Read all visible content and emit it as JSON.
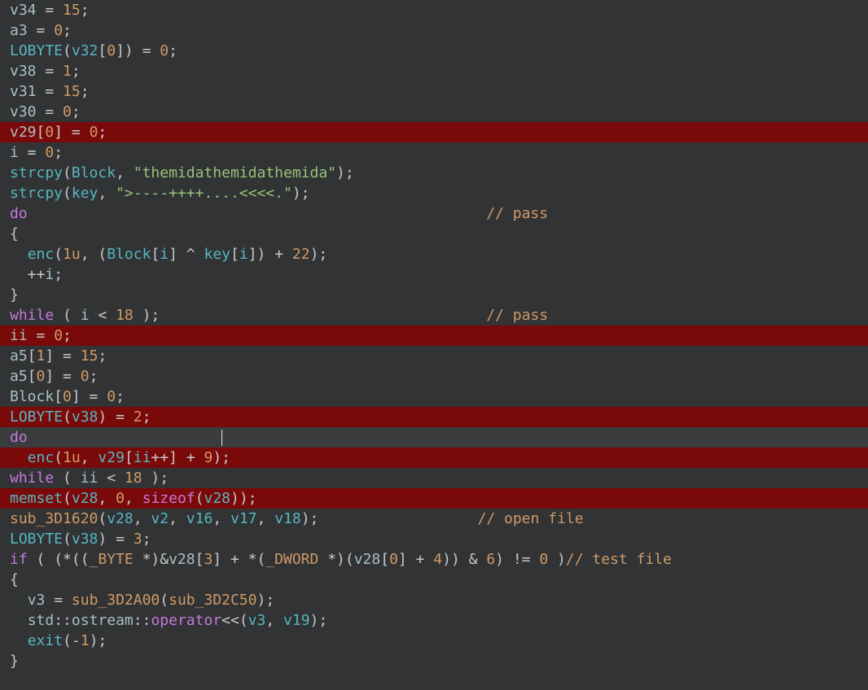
{
  "lines": [
    {
      "hl": "",
      "tokens": [
        {
          "t": "v34",
          "c": "c-var"
        },
        {
          "t": " = ",
          "c": "c-punc"
        },
        {
          "t": "15",
          "c": "c-num"
        },
        {
          "t": ";",
          "c": "c-punc"
        }
      ]
    },
    {
      "hl": "",
      "tokens": [
        {
          "t": "a3",
          "c": "c-var"
        },
        {
          "t": " = ",
          "c": "c-punc"
        },
        {
          "t": "0",
          "c": "c-num"
        },
        {
          "t": ";",
          "c": "c-punc"
        }
      ]
    },
    {
      "hl": "",
      "tokens": [
        {
          "t": "LOBYTE",
          "c": "c-func"
        },
        {
          "t": "(",
          "c": "c-punc"
        },
        {
          "t": "v32",
          "c": "c-id"
        },
        {
          "t": "[",
          "c": "c-punc"
        },
        {
          "t": "0",
          "c": "c-num"
        },
        {
          "t": "]) = ",
          "c": "c-punc"
        },
        {
          "t": "0",
          "c": "c-num"
        },
        {
          "t": ";",
          "c": "c-punc"
        }
      ]
    },
    {
      "hl": "",
      "tokens": [
        {
          "t": "v38",
          "c": "c-var"
        },
        {
          "t": " = ",
          "c": "c-punc"
        },
        {
          "t": "1",
          "c": "c-num"
        },
        {
          "t": ";",
          "c": "c-punc"
        }
      ]
    },
    {
      "hl": "",
      "tokens": [
        {
          "t": "v31",
          "c": "c-var"
        },
        {
          "t": " = ",
          "c": "c-punc"
        },
        {
          "t": "15",
          "c": "c-num"
        },
        {
          "t": ";",
          "c": "c-punc"
        }
      ]
    },
    {
      "hl": "",
      "tokens": [
        {
          "t": "v30",
          "c": "c-var"
        },
        {
          "t": " = ",
          "c": "c-punc"
        },
        {
          "t": "0",
          "c": "c-num"
        },
        {
          "t": ";",
          "c": "c-punc"
        }
      ]
    },
    {
      "hl": "hl-red",
      "tokens": [
        {
          "t": "v29",
          "c": "c-var"
        },
        {
          "t": "[",
          "c": "c-punc"
        },
        {
          "t": "0",
          "c": "c-num"
        },
        {
          "t": "] = ",
          "c": "c-punc"
        },
        {
          "t": "0",
          "c": "c-num"
        },
        {
          "t": ";",
          "c": "c-punc"
        }
      ]
    },
    {
      "hl": "",
      "tokens": [
        {
          "t": "i",
          "c": "c-var"
        },
        {
          "t": " = ",
          "c": "c-punc"
        },
        {
          "t": "0",
          "c": "c-num"
        },
        {
          "t": ";",
          "c": "c-punc"
        }
      ]
    },
    {
      "hl": "",
      "tokens": [
        {
          "t": "strcpy",
          "c": "c-func"
        },
        {
          "t": "(",
          "c": "c-punc"
        },
        {
          "t": "Block",
          "c": "c-id"
        },
        {
          "t": ", ",
          "c": "c-punc"
        },
        {
          "t": "\"themidathemidathemida\"",
          "c": "c-str"
        },
        {
          "t": ");",
          "c": "c-punc"
        }
      ]
    },
    {
      "hl": "",
      "tokens": [
        {
          "t": "strcpy",
          "c": "c-func"
        },
        {
          "t": "(",
          "c": "c-punc"
        },
        {
          "t": "key",
          "c": "c-id"
        },
        {
          "t": ", ",
          "c": "c-punc"
        },
        {
          "t": "\">----++++....<<<<.\"",
          "c": "c-str"
        },
        {
          "t": ");",
          "c": "c-punc"
        }
      ]
    },
    {
      "hl": "",
      "tokens": [
        {
          "t": "do",
          "c": "c-kw"
        },
        {
          "t": "                                                    ",
          "c": "c-punc"
        },
        {
          "t": "// pass",
          "c": "c-cmt"
        }
      ]
    },
    {
      "hl": "",
      "tokens": [
        {
          "t": "{",
          "c": "c-punc"
        }
      ]
    },
    {
      "hl": "",
      "tokens": [
        {
          "t": "  ",
          "c": "c-punc"
        },
        {
          "t": "enc",
          "c": "c-func"
        },
        {
          "t": "(",
          "c": "c-punc"
        },
        {
          "t": "1u",
          "c": "c-num"
        },
        {
          "t": ", (",
          "c": "c-punc"
        },
        {
          "t": "Block",
          "c": "c-id"
        },
        {
          "t": "[",
          "c": "c-punc"
        },
        {
          "t": "i",
          "c": "c-id"
        },
        {
          "t": "] ^ ",
          "c": "c-punc"
        },
        {
          "t": "key",
          "c": "c-id"
        },
        {
          "t": "[",
          "c": "c-punc"
        },
        {
          "t": "i",
          "c": "c-id"
        },
        {
          "t": "]) + ",
          "c": "c-punc"
        },
        {
          "t": "22",
          "c": "c-num"
        },
        {
          "t": ");",
          "c": "c-punc"
        }
      ]
    },
    {
      "hl": "",
      "tokens": [
        {
          "t": "  ++",
          "c": "c-punc"
        },
        {
          "t": "i",
          "c": "c-var"
        },
        {
          "t": ";",
          "c": "c-punc"
        }
      ]
    },
    {
      "hl": "",
      "tokens": [
        {
          "t": "}",
          "c": "c-punc"
        }
      ]
    },
    {
      "hl": "",
      "tokens": [
        {
          "t": "while",
          "c": "c-kw"
        },
        {
          "t": " ( ",
          "c": "c-punc"
        },
        {
          "t": "i",
          "c": "c-var"
        },
        {
          "t": " < ",
          "c": "c-punc"
        },
        {
          "t": "18",
          "c": "c-num"
        },
        {
          "t": " );",
          "c": "c-punc"
        },
        {
          "t": "                                     ",
          "c": "c-punc"
        },
        {
          "t": "// pass",
          "c": "c-cmt"
        }
      ]
    },
    {
      "hl": "hl-red",
      "tokens": [
        {
          "t": "ii",
          "c": "c-var"
        },
        {
          "t": " = ",
          "c": "c-punc"
        },
        {
          "t": "0",
          "c": "c-num"
        },
        {
          "t": ";",
          "c": "c-punc"
        }
      ]
    },
    {
      "hl": "",
      "tokens": [
        {
          "t": "a5",
          "c": "c-var"
        },
        {
          "t": "[",
          "c": "c-punc"
        },
        {
          "t": "1",
          "c": "c-num"
        },
        {
          "t": "] = ",
          "c": "c-punc"
        },
        {
          "t": "15",
          "c": "c-num"
        },
        {
          "t": ";",
          "c": "c-punc"
        }
      ]
    },
    {
      "hl": "",
      "tokens": [
        {
          "t": "a5",
          "c": "c-var"
        },
        {
          "t": "[",
          "c": "c-punc"
        },
        {
          "t": "0",
          "c": "c-num"
        },
        {
          "t": "] = ",
          "c": "c-punc"
        },
        {
          "t": "0",
          "c": "c-num"
        },
        {
          "t": ";",
          "c": "c-punc"
        }
      ]
    },
    {
      "hl": "",
      "tokens": [
        {
          "t": "Block",
          "c": "c-var"
        },
        {
          "t": "[",
          "c": "c-punc"
        },
        {
          "t": "0",
          "c": "c-num"
        },
        {
          "t": "] = ",
          "c": "c-punc"
        },
        {
          "t": "0",
          "c": "c-num"
        },
        {
          "t": ";",
          "c": "c-punc"
        }
      ]
    },
    {
      "hl": "hl-red",
      "tokens": [
        {
          "t": "LOBYTE",
          "c": "c-func"
        },
        {
          "t": "(",
          "c": "c-punc"
        },
        {
          "t": "v38",
          "c": "c-id"
        },
        {
          "t": ") = ",
          "c": "c-punc"
        },
        {
          "t": "2",
          "c": "c-num"
        },
        {
          "t": ";",
          "c": "c-punc"
        }
      ]
    },
    {
      "hl": "hl-grey",
      "caret_at": 2,
      "tokens": [
        {
          "t": "do",
          "c": "c-kw"
        }
      ]
    },
    {
      "hl": "hl-red",
      "tokens": [
        {
          "t": "  ",
          "c": "c-punc"
        },
        {
          "t": "enc",
          "c": "c-func"
        },
        {
          "t": "(",
          "c": "c-punc"
        },
        {
          "t": "1u",
          "c": "c-num"
        },
        {
          "t": ", ",
          "c": "c-punc"
        },
        {
          "t": "v29",
          "c": "c-id"
        },
        {
          "t": "[",
          "c": "c-punc"
        },
        {
          "t": "ii",
          "c": "c-id"
        },
        {
          "t": "++] + ",
          "c": "c-punc"
        },
        {
          "t": "9",
          "c": "c-num"
        },
        {
          "t": ");",
          "c": "c-punc"
        }
      ]
    },
    {
      "hl": "",
      "tokens": [
        {
          "t": "while",
          "c": "c-kw"
        },
        {
          "t": " ( ",
          "c": "c-punc"
        },
        {
          "t": "ii",
          "c": "c-var"
        },
        {
          "t": " < ",
          "c": "c-punc"
        },
        {
          "t": "18",
          "c": "c-num"
        },
        {
          "t": " );",
          "c": "c-punc"
        }
      ]
    },
    {
      "hl": "hl-red",
      "tokens": [
        {
          "t": "memset",
          "c": "c-func"
        },
        {
          "t": "(",
          "c": "c-punc"
        },
        {
          "t": "v28",
          "c": "c-id"
        },
        {
          "t": ", ",
          "c": "c-punc"
        },
        {
          "t": "0",
          "c": "c-num"
        },
        {
          "t": ", ",
          "c": "c-punc"
        },
        {
          "t": "sizeof",
          "c": "c-kw"
        },
        {
          "t": "(",
          "c": "c-punc"
        },
        {
          "t": "v28",
          "c": "c-id"
        },
        {
          "t": "));",
          "c": "c-punc"
        }
      ]
    },
    {
      "hl": "",
      "tokens": [
        {
          "t": "sub_3D1620",
          "c": "c-sub"
        },
        {
          "t": "(",
          "c": "c-punc"
        },
        {
          "t": "v28",
          "c": "c-id"
        },
        {
          "t": ", ",
          "c": "c-punc"
        },
        {
          "t": "v2",
          "c": "c-id"
        },
        {
          "t": ", ",
          "c": "c-punc"
        },
        {
          "t": "v16",
          "c": "c-id"
        },
        {
          "t": ", ",
          "c": "c-punc"
        },
        {
          "t": "v17",
          "c": "c-id"
        },
        {
          "t": ", ",
          "c": "c-punc"
        },
        {
          "t": "v18",
          "c": "c-id"
        },
        {
          "t": ");",
          "c": "c-punc"
        },
        {
          "t": "                  ",
          "c": "c-punc"
        },
        {
          "t": "// open file",
          "c": "c-cmt"
        }
      ]
    },
    {
      "hl": "",
      "tokens": [
        {
          "t": "LOBYTE",
          "c": "c-func"
        },
        {
          "t": "(",
          "c": "c-punc"
        },
        {
          "t": "v38",
          "c": "c-id"
        },
        {
          "t": ") = ",
          "c": "c-punc"
        },
        {
          "t": "3",
          "c": "c-num"
        },
        {
          "t": ";",
          "c": "c-punc"
        }
      ]
    },
    {
      "hl": "",
      "tokens": [
        {
          "t": "if",
          "c": "c-kw"
        },
        {
          "t": " ( (*((",
          "c": "c-punc"
        },
        {
          "t": "_BYTE",
          "c": "c-type"
        },
        {
          "t": " *)&",
          "c": "c-punc"
        },
        {
          "t": "v28",
          "c": "c-var"
        },
        {
          "t": "[",
          "c": "c-punc"
        },
        {
          "t": "3",
          "c": "c-num"
        },
        {
          "t": "] + *(",
          "c": "c-punc"
        },
        {
          "t": "_DWORD",
          "c": "c-type"
        },
        {
          "t": " *)(",
          "c": "c-punc"
        },
        {
          "t": "v28",
          "c": "c-var"
        },
        {
          "t": "[",
          "c": "c-punc"
        },
        {
          "t": "0",
          "c": "c-num"
        },
        {
          "t": "] + ",
          "c": "c-punc"
        },
        {
          "t": "4",
          "c": "c-num"
        },
        {
          "t": ")) & ",
          "c": "c-punc"
        },
        {
          "t": "6",
          "c": "c-num"
        },
        {
          "t": ") != ",
          "c": "c-punc"
        },
        {
          "t": "0",
          "c": "c-num"
        },
        {
          "t": " )",
          "c": "c-punc"
        },
        {
          "t": "// test file",
          "c": "c-cmt"
        }
      ]
    },
    {
      "hl": "",
      "tokens": [
        {
          "t": "{",
          "c": "c-punc"
        }
      ]
    },
    {
      "hl": "",
      "tokens": [
        {
          "t": "  ",
          "c": "c-punc"
        },
        {
          "t": "v3",
          "c": "c-var"
        },
        {
          "t": " = ",
          "c": "c-punc"
        },
        {
          "t": "sub_3D2A00",
          "c": "c-sub"
        },
        {
          "t": "(",
          "c": "c-punc"
        },
        {
          "t": "sub_3D2C50",
          "c": "c-sub"
        },
        {
          "t": ");",
          "c": "c-punc"
        }
      ]
    },
    {
      "hl": "",
      "tokens": [
        {
          "t": "  ",
          "c": "c-punc"
        },
        {
          "t": "std",
          "c": "c-ns"
        },
        {
          "t": "::",
          "c": "c-punc"
        },
        {
          "t": "ostream",
          "c": "c-ns"
        },
        {
          "t": "::",
          "c": "c-punc"
        },
        {
          "t": "operator",
          "c": "c-kw"
        },
        {
          "t": "<<(",
          "c": "c-punc"
        },
        {
          "t": "v3",
          "c": "c-id"
        },
        {
          "t": ", ",
          "c": "c-punc"
        },
        {
          "t": "v19",
          "c": "c-id"
        },
        {
          "t": ");",
          "c": "c-punc"
        }
      ]
    },
    {
      "hl": "",
      "tokens": [
        {
          "t": "  ",
          "c": "c-punc"
        },
        {
          "t": "exit",
          "c": "c-func"
        },
        {
          "t": "(-",
          "c": "c-punc"
        },
        {
          "t": "1",
          "c": "c-num"
        },
        {
          "t": ");",
          "c": "c-punc"
        }
      ]
    },
    {
      "hl": "",
      "tokens": [
        {
          "t": "}",
          "c": "c-punc"
        }
      ]
    }
  ]
}
